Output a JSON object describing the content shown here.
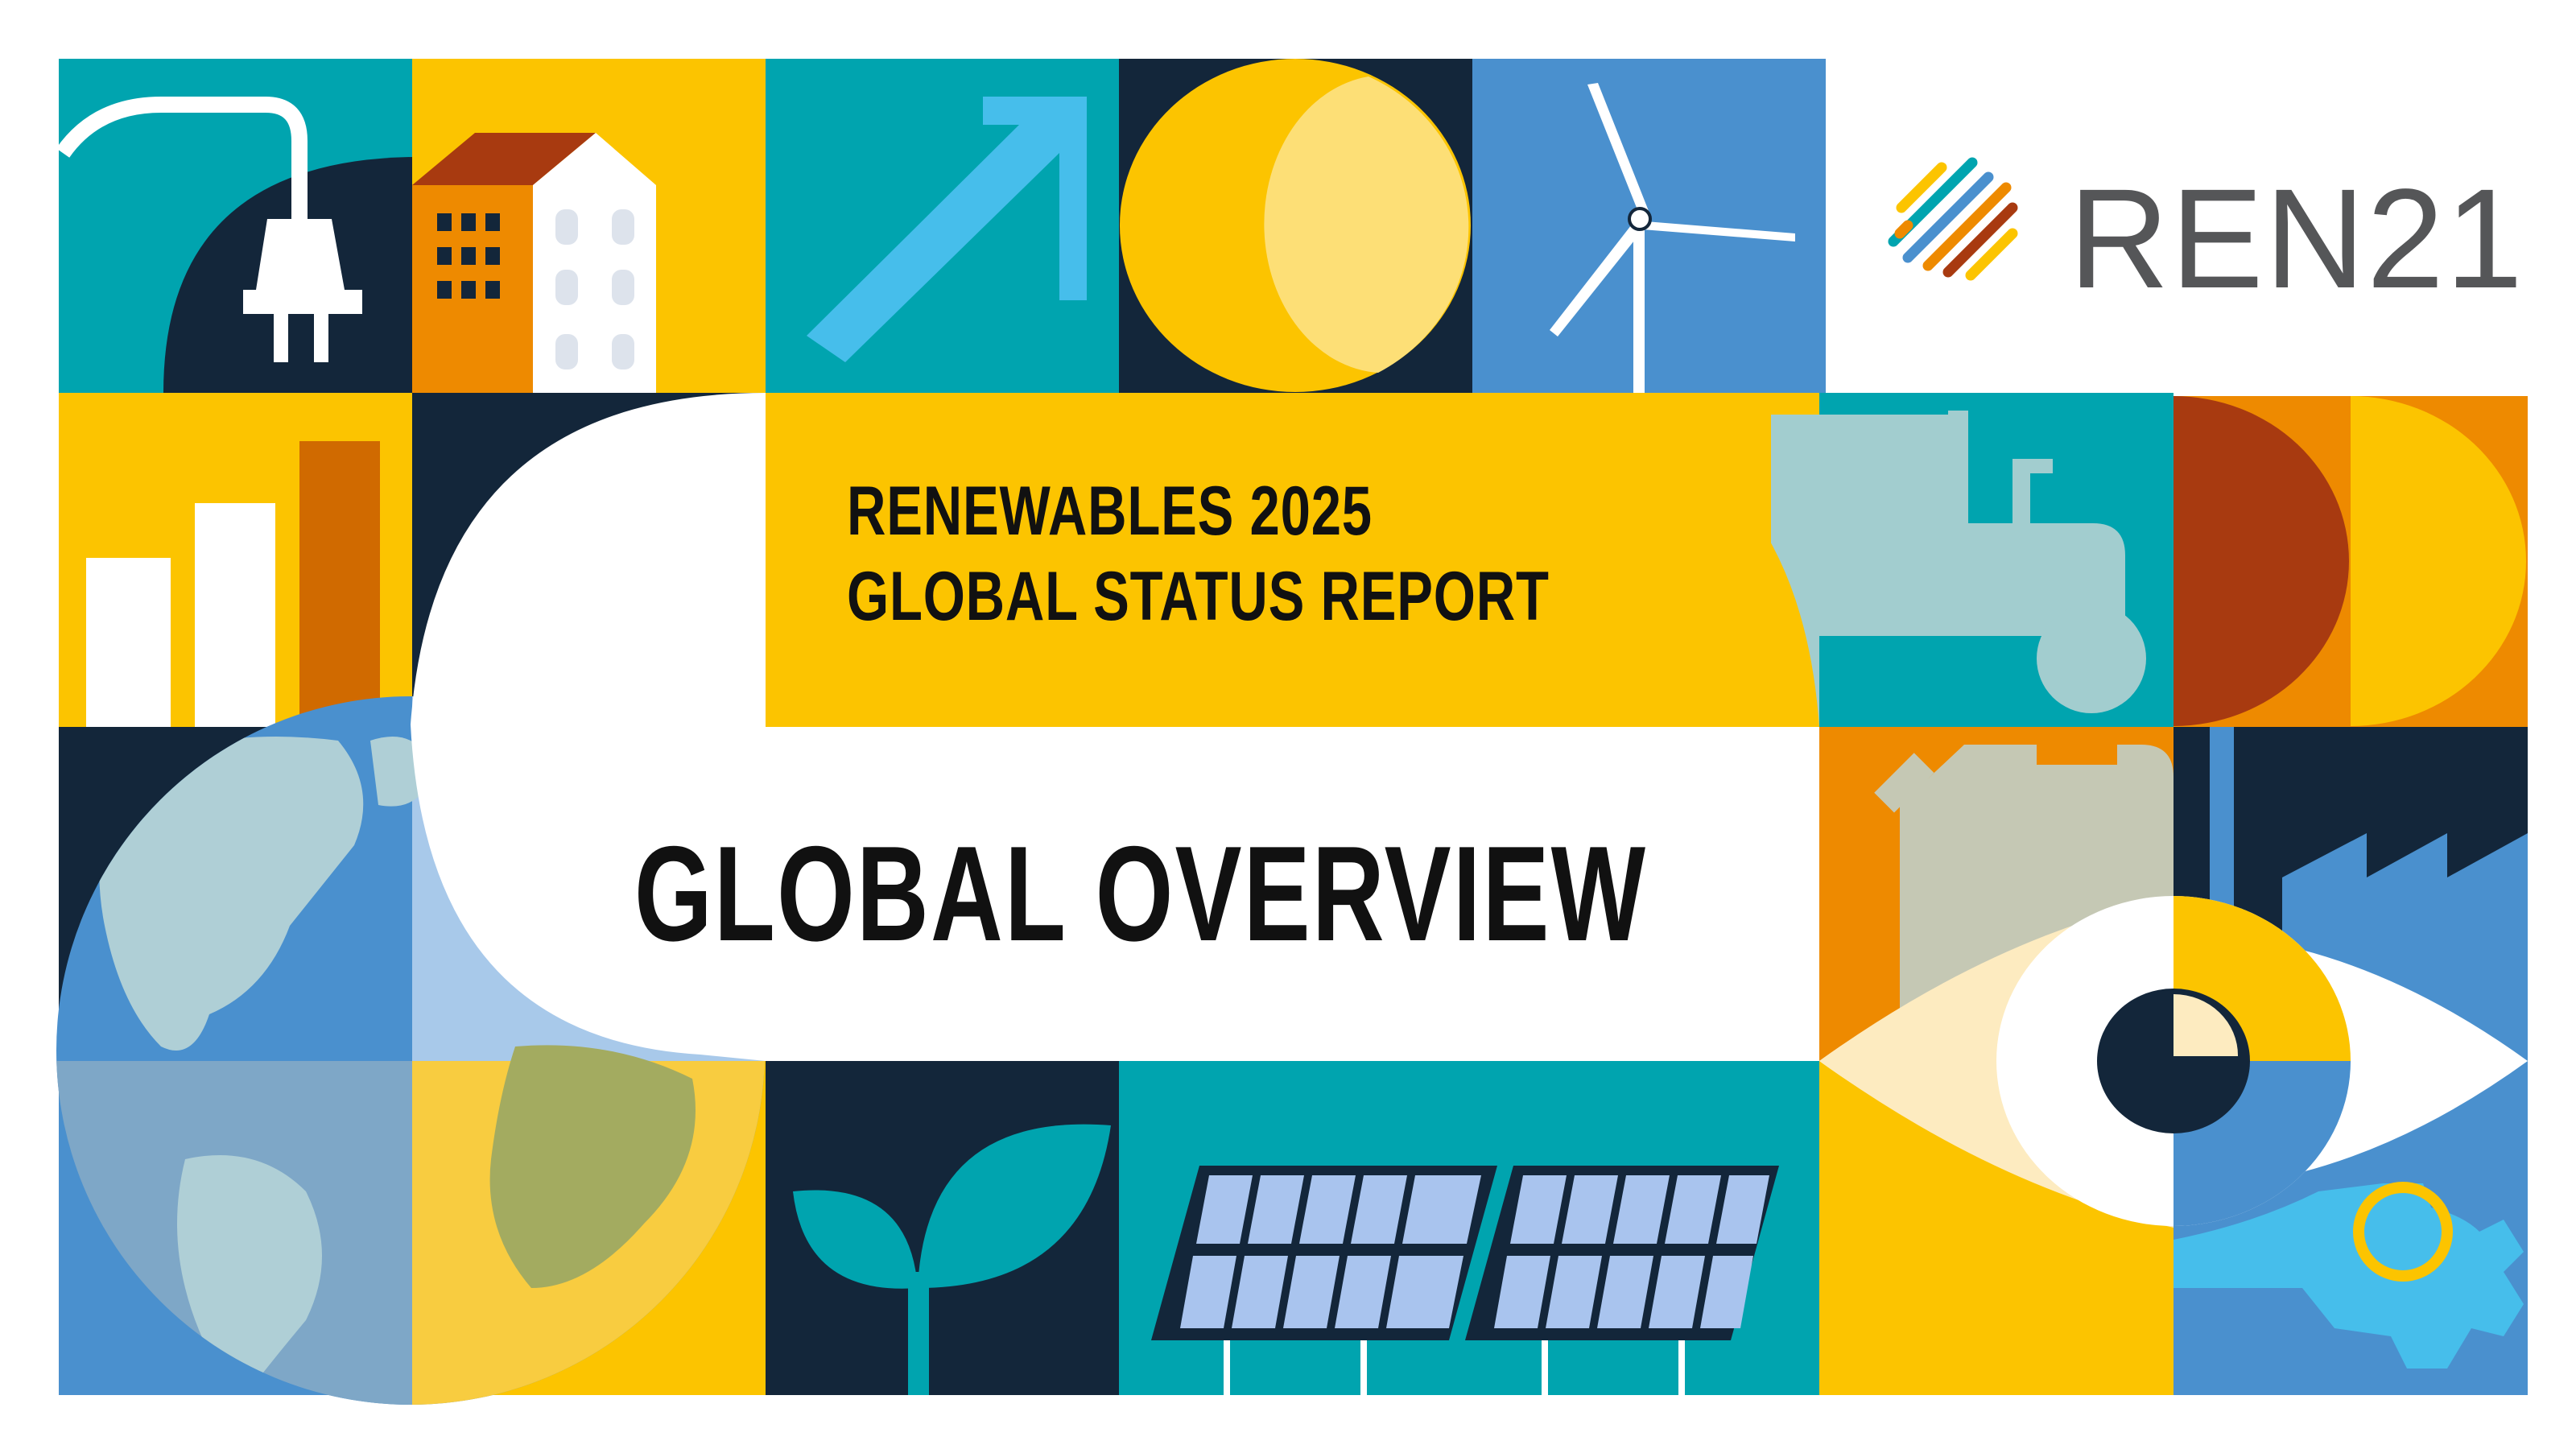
{
  "cover": {
    "report_line_1": "RENEWABLES 2025",
    "report_line_2": "GLOBAL STATUS REPORT",
    "section_title": "GLOBAL OVERVIEW"
  },
  "logo": {
    "text": "REN21",
    "icon": "ren21-stripes-icon"
  },
  "palette": {
    "teal": "#00A4AF",
    "yellow": "#FCC400",
    "navy": "#13263A",
    "blue": "#4A90CE",
    "orange": "#EE8A00",
    "rust": "#A83A10",
    "light_blue": "#46BEEB",
    "pale_yellow": "#FDDF76"
  },
  "icons": [
    "power-plug-icon",
    "house-icon",
    "growth-arrow-icon",
    "sun-icon",
    "wind-turbine-icon",
    "bar-chart-icon",
    "tractor-icon",
    "half-circles-icon",
    "globe-icon",
    "fuel-can-icon",
    "factory-icon",
    "eye-icon",
    "sprout-icon",
    "solar-panel-icon",
    "gear-icon"
  ]
}
